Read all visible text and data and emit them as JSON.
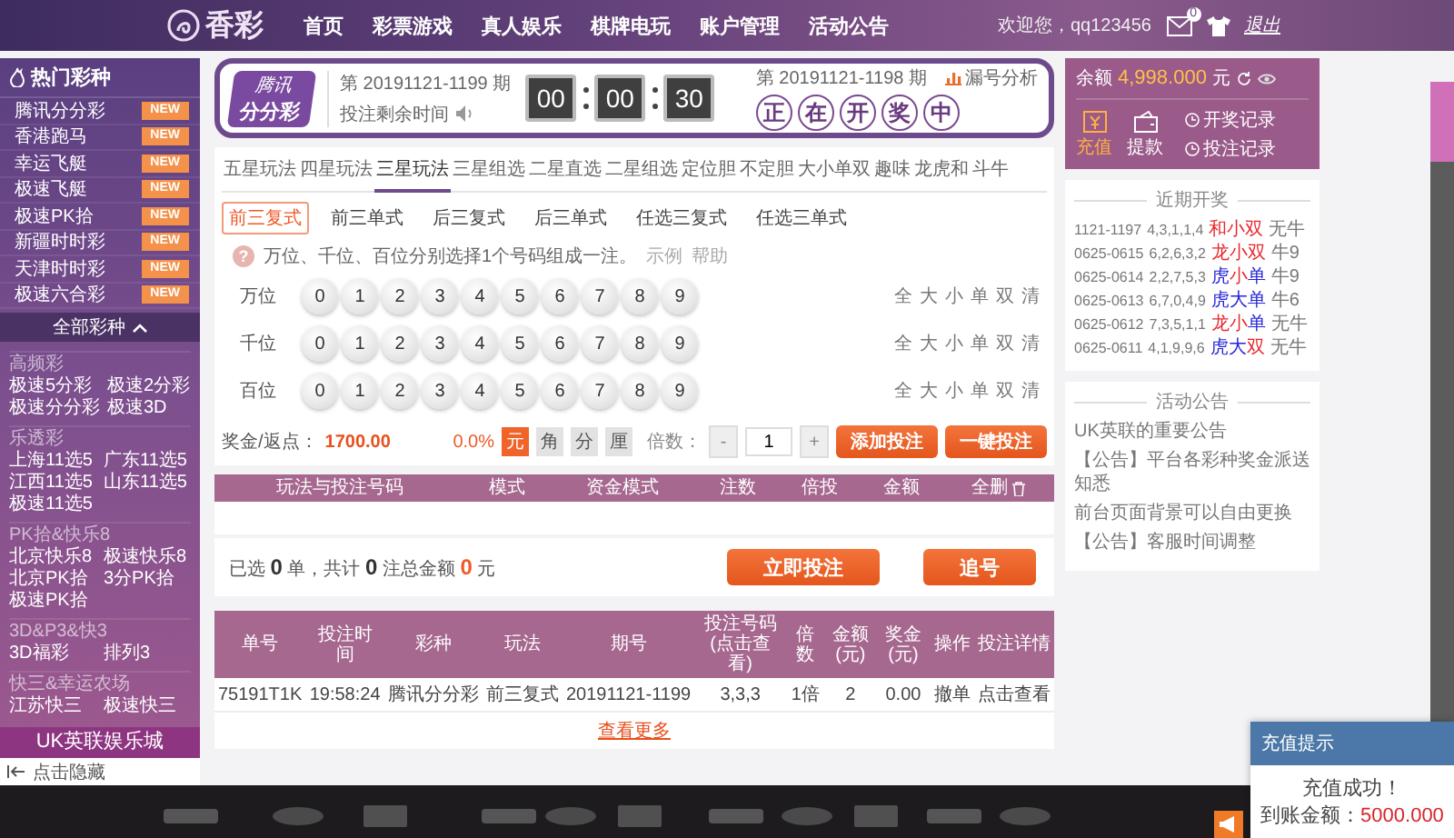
{
  "header": {
    "logo": "香彩",
    "nav": [
      {
        "label": "首页"
      },
      {
        "label": "彩票游戏"
      },
      {
        "label": "真人娱乐"
      },
      {
        "label": "棋牌电玩"
      },
      {
        "label": "账户管理"
      },
      {
        "label": "活动公告"
      }
    ],
    "welcome": "欢迎您，qq123456",
    "mail_count": "0",
    "logout": "退出"
  },
  "sidebar": {
    "hot_title": "热门彩种",
    "hot": [
      {
        "name": "腾讯分分彩",
        "badge": "NEW"
      },
      {
        "name": "香港跑马",
        "badge": "NEW"
      },
      {
        "name": "幸运飞艇",
        "badge": "NEW"
      },
      {
        "name": "极速飞艇",
        "badge": "NEW"
      },
      {
        "name": "极速PK拾",
        "badge": "NEW"
      },
      {
        "name": "新疆时时彩",
        "badge": "NEW"
      },
      {
        "name": "天津时时彩",
        "badge": "NEW"
      },
      {
        "name": "极速六合彩",
        "badge": "NEW"
      }
    ],
    "all_title": "全部彩种",
    "all_expanded": true,
    "groups": [
      {
        "title": "高频彩",
        "items": [
          "极速5分彩",
          "极速2分彩",
          "极速分分彩",
          "极速3D"
        ]
      },
      {
        "title": "乐透彩",
        "items": [
          "上海11选5",
          "广东11选5",
          "江西11选5",
          "山东11选5",
          "极速11选5"
        ]
      },
      {
        "title": "PK拾&快乐8",
        "items": [
          "北京快乐8",
          "极速快乐8",
          "北京PK拾",
          "3分PK拾",
          "极速PK拾"
        ]
      },
      {
        "title": "3D&P3&快3",
        "items": [
          "3D福彩",
          "排列3"
        ]
      },
      {
        "title": "快三&幸运农场",
        "items": [
          "江苏快三",
          "极速快三"
        ]
      }
    ],
    "brand": "UK英联娱乐城",
    "hide": "点击隐藏"
  },
  "lottery": {
    "logo_top": "腾讯",
    "logo_bottom": "分分彩",
    "current_issue": "第 20191121-1199 期",
    "countdown_label": "投注剩余时间",
    "timer": [
      "00",
      "00",
      "30"
    ],
    "last_issue": "第 20191121-1198 期",
    "analysis": "漏号分析",
    "draw_status": [
      "正",
      "在",
      "开",
      "奖",
      "中"
    ]
  },
  "play_tabs": [
    {
      "label": "五星玩法",
      "selected": false
    },
    {
      "label": "四星玩法",
      "selected": false
    },
    {
      "label": "三星玩法",
      "selected": true
    },
    {
      "label": "三星组选",
      "selected": false
    },
    {
      "label": "二星直选",
      "selected": false
    },
    {
      "label": "二星组选",
      "selected": false
    },
    {
      "label": "定位胆",
      "selected": false
    },
    {
      "label": "不定胆",
      "selected": false
    },
    {
      "label": "大小单双",
      "selected": false
    },
    {
      "label": "趣味",
      "selected": false
    },
    {
      "label": "龙虎和",
      "selected": false
    },
    {
      "label": "斗牛",
      "selected": false
    }
  ],
  "sub_tabs": [
    {
      "label": "前三复式",
      "selected": true
    },
    {
      "label": "前三单式",
      "selected": false
    },
    {
      "label": "后三复式",
      "selected": false
    },
    {
      "label": "后三单式",
      "selected": false
    },
    {
      "label": "任选三复式",
      "selected": false
    },
    {
      "label": "任选三单式",
      "selected": false
    }
  ],
  "hint": {
    "icon": "?",
    "text": "万位、千位、百位分别选择1个号码组成一注。",
    "example": "示例",
    "help": "帮助"
  },
  "positions": [
    {
      "label": "万位",
      "balls": [
        "0",
        "1",
        "2",
        "3",
        "4",
        "5",
        "6",
        "7",
        "8",
        "9"
      ],
      "shortcuts": [
        "全",
        "大",
        "小",
        "单",
        "双",
        "清"
      ]
    },
    {
      "label": "千位",
      "balls": [
        "0",
        "1",
        "2",
        "3",
        "4",
        "5",
        "6",
        "7",
        "8",
        "9"
      ],
      "shortcuts": [
        "全",
        "大",
        "小",
        "单",
        "双",
        "清"
      ]
    },
    {
      "label": "百位",
      "balls": [
        "0",
        "1",
        "2",
        "3",
        "4",
        "5",
        "6",
        "7",
        "8",
        "9"
      ],
      "shortcuts": [
        "全",
        "大",
        "小",
        "单",
        "双",
        "清"
      ]
    }
  ],
  "bet_bar": {
    "prize_label": "奖金/返点：",
    "prize": "1700.00",
    "rebate": "0.0%",
    "modes": [
      {
        "label": "元",
        "selected": true
      },
      {
        "label": "角",
        "selected": false
      },
      {
        "label": "分",
        "selected": false
      },
      {
        "label": "厘",
        "selected": false
      }
    ],
    "multiplier_label": "倍数：",
    "minus": "-",
    "multiplier": "1",
    "plus": "+",
    "add": "添加投注",
    "quick": "一键投注"
  },
  "cart": {
    "columns": [
      "玩法与投注号码",
      "模式",
      "资金模式",
      "注数",
      "倍投",
      "金额",
      "全删"
    ],
    "summary": "已选 **0** 单，共计 **0** 注总金额 **0** 元",
    "submit": "立即投注",
    "chase": "追号"
  },
  "records": {
    "columns": [
      "单号",
      "投注时间",
      "彩种",
      "玩法",
      "期号",
      "投注号码(点击查看)",
      "倍数",
      "金额(元)",
      "奖金(元)",
      "操作",
      "投注详情"
    ],
    "rows": [
      [
        "75191T1K",
        "19:58:24",
        "腾讯分分彩",
        "前三复式",
        "20191121-1199",
        "3,3,3",
        "1倍",
        "2",
        "0.00",
        "撤单",
        "点击查看"
      ]
    ],
    "more": "查看更多"
  },
  "account": {
    "balance_label": "余额",
    "balance": "4,998.000",
    "unit": "元",
    "actions": [
      {
        "label": "充值",
        "selected": true
      },
      {
        "label": "提款",
        "selected": false
      }
    ],
    "links": [
      "开奖记录",
      "投注记录"
    ]
  },
  "recent": {
    "title": "近期开奖",
    "rows": [
      {
        "issue": "1121-1197",
        "numbers": "4,3,1,1,4",
        "tags": [
          {
            "text": "和",
            "color": "#e8262b"
          },
          {
            "text": "小",
            "color": "#e8262b"
          },
          {
            "text": "双",
            "color": "#e8262b"
          }
        ],
        "niu": "无牛"
      },
      {
        "issue": "0625-0615",
        "numbers": "6,2,6,3,2",
        "tags": [
          {
            "text": "龙",
            "color": "#e8262b"
          },
          {
            "text": "小",
            "color": "#e8262b"
          },
          {
            "text": "双",
            "color": "#e8262b"
          }
        ],
        "niu": "牛9"
      },
      {
        "issue": "0625-0614",
        "numbers": "2,2,7,5,3",
        "tags": [
          {
            "text": "虎",
            "color": "#2424d8"
          },
          {
            "text": "小",
            "color": "#e8262b"
          },
          {
            "text": "单",
            "color": "#2424d8"
          }
        ],
        "niu": "牛9"
      },
      {
        "issue": "0625-0613",
        "numbers": "6,7,0,4,9",
        "tags": [
          {
            "text": "虎",
            "color": "#2424d8"
          },
          {
            "text": "大",
            "color": "#2424d8"
          },
          {
            "text": "单",
            "color": "#2424d8"
          }
        ],
        "niu": "牛6"
      },
      {
        "issue": "0625-0612",
        "numbers": "7,3,5,1,1",
        "tags": [
          {
            "text": "龙",
            "color": "#e8262b"
          },
          {
            "text": "小",
            "color": "#e8262b"
          },
          {
            "text": "单",
            "color": "#2424d8"
          }
        ],
        "niu": "无牛"
      },
      {
        "issue": "0625-0611",
        "numbers": "4,1,9,9,6",
        "tags": [
          {
            "text": "虎",
            "color": "#2424d8"
          },
          {
            "text": "大",
            "color": "#2424d8"
          },
          {
            "text": "双",
            "color": "#e8262b"
          }
        ],
        "niu": "无牛"
      }
    ]
  },
  "notices": {
    "title": "活动公告",
    "items": [
      "UK英联的重要公告",
      "【公告】平台各彩种奖金派送知悉",
      "前台页面背景可以自由更换",
      "【公告】客服时间调整"
    ]
  },
  "popup": {
    "title": "充值提示",
    "message": "充值成功！",
    "amount_label": "到账金额：",
    "amount": "5000.000"
  }
}
